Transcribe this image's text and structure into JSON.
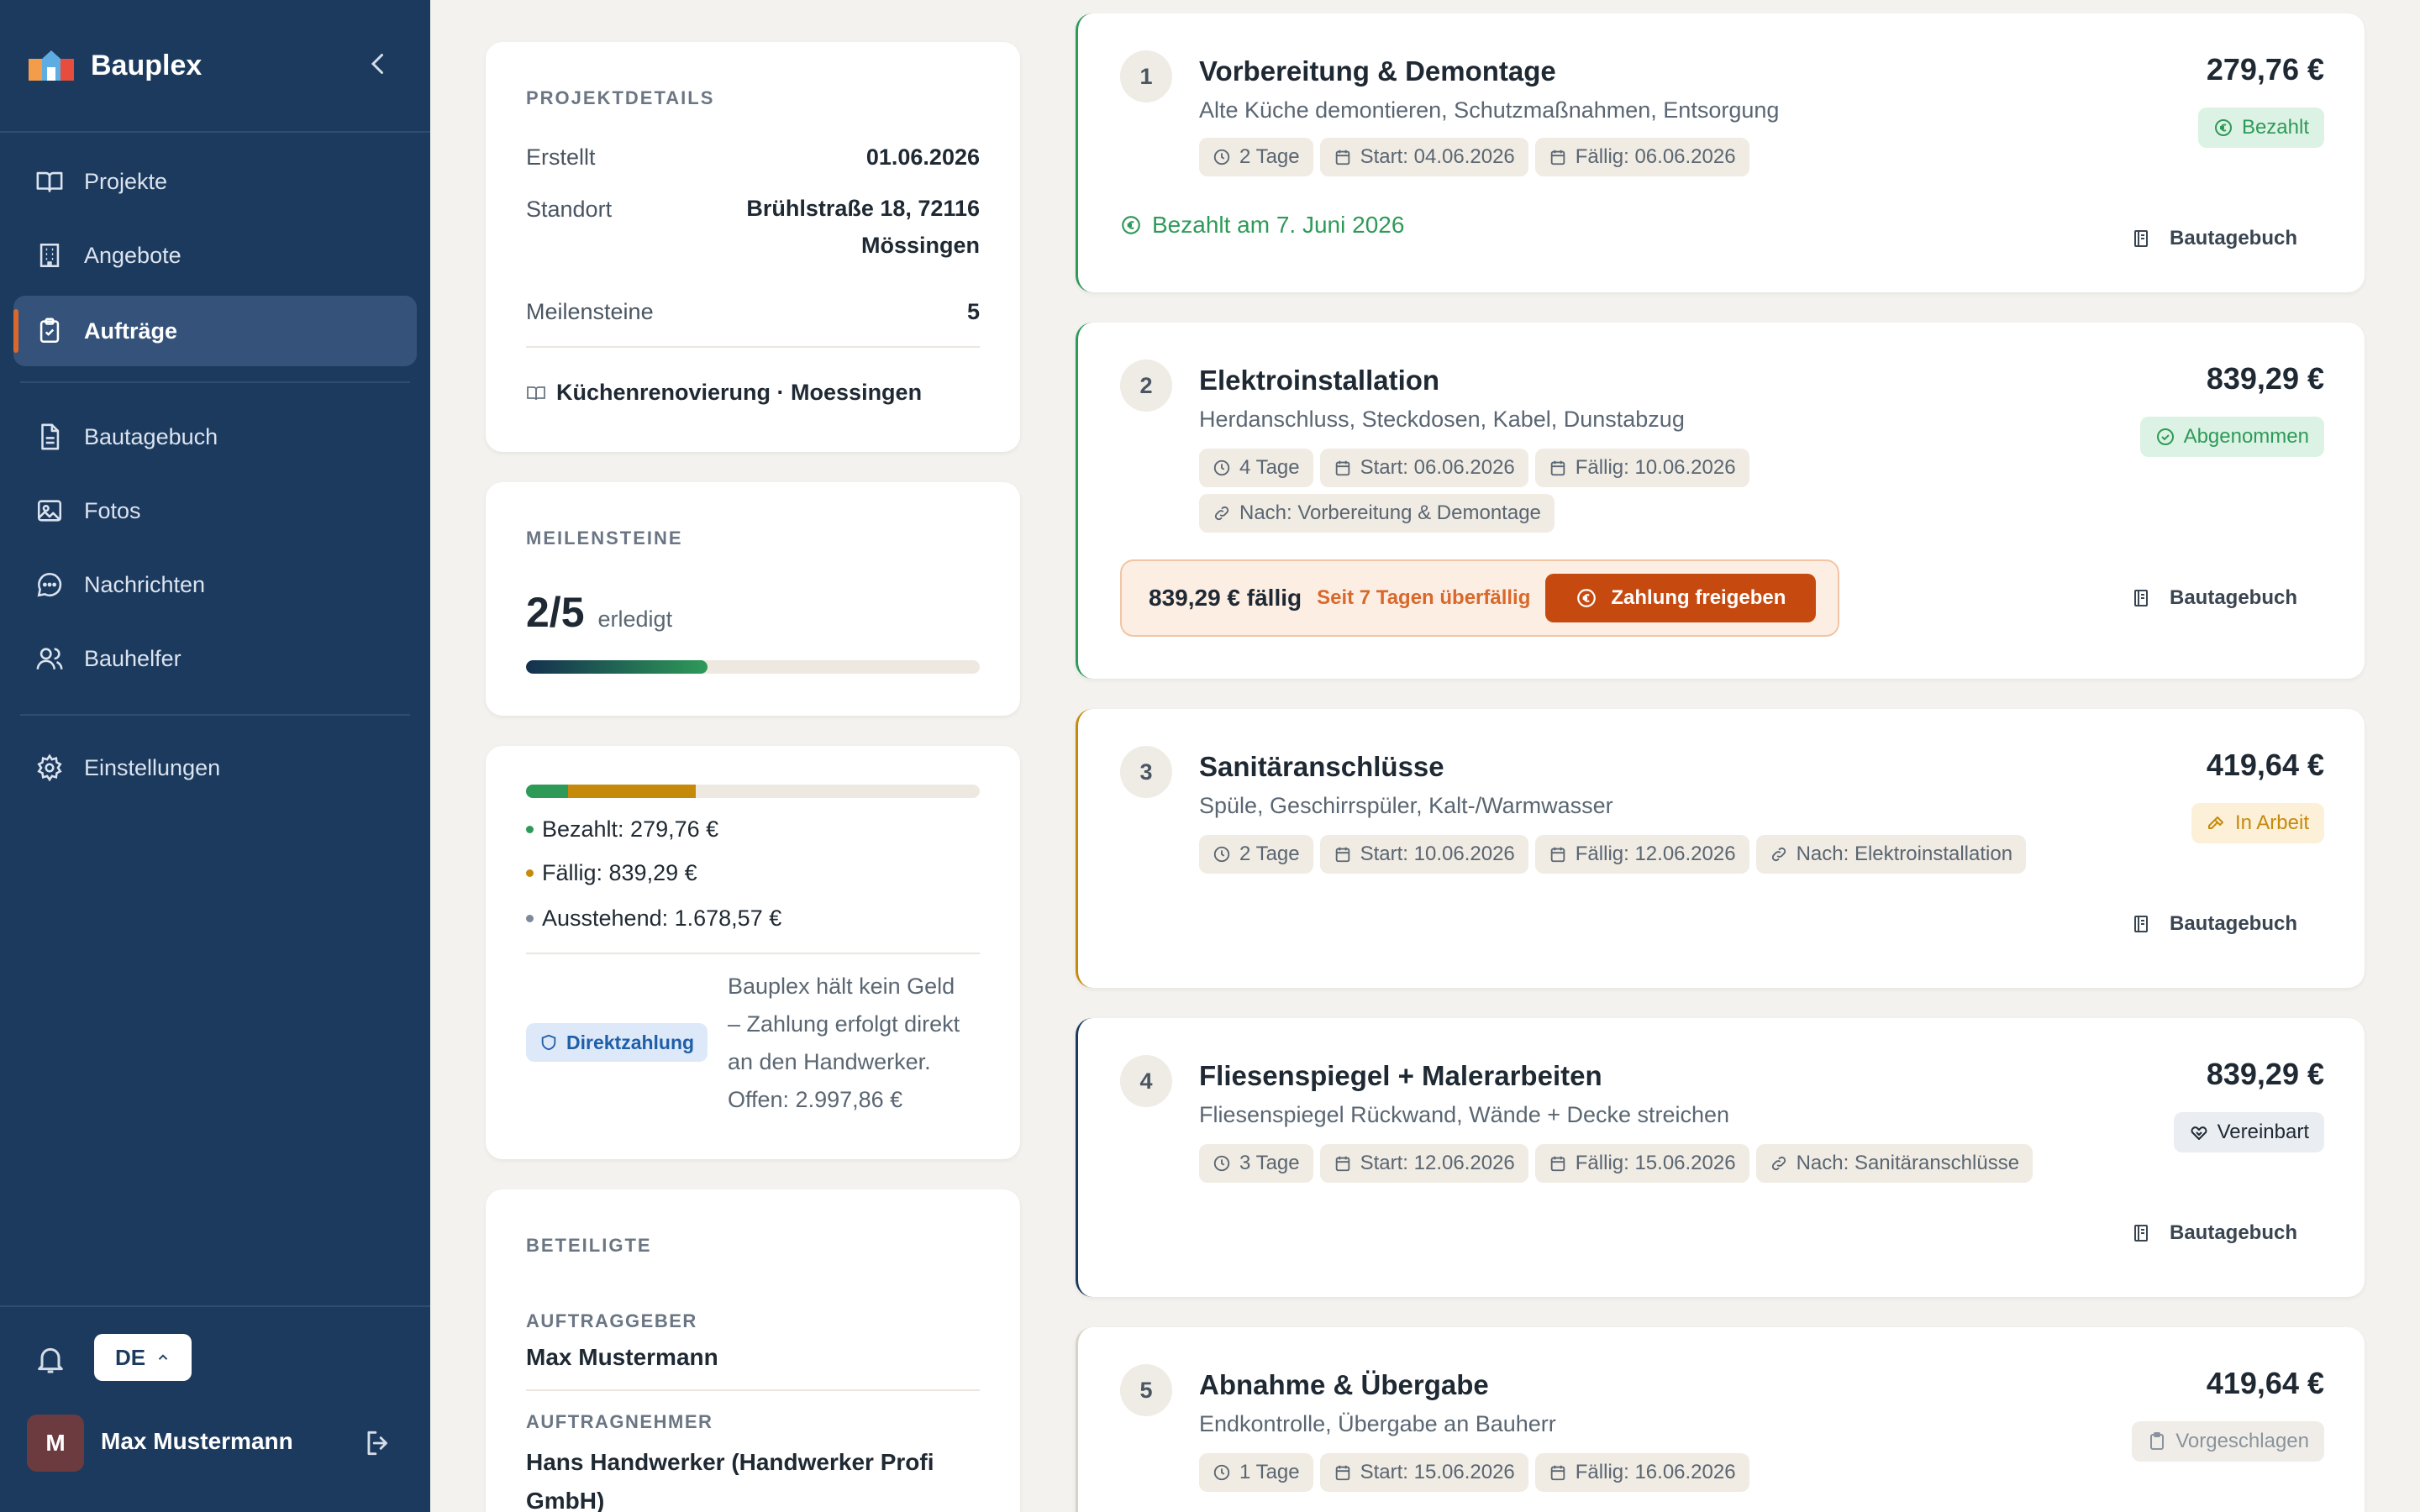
{
  "app": {
    "name": "Bauplex"
  },
  "sidebar": {
    "nav": [
      {
        "label": "Projekte",
        "icon": "book-icon"
      },
      {
        "label": "Angebote",
        "icon": "building-icon"
      },
      {
        "label": "Aufträge",
        "icon": "clipboard-check-icon",
        "active": true
      },
      {
        "label": "Bautagebuch",
        "icon": "document-icon"
      },
      {
        "label": "Fotos",
        "icon": "image-icon"
      },
      {
        "label": "Nachrichten",
        "icon": "chat-icon"
      },
      {
        "label": "Bauhelfer",
        "icon": "users-icon"
      },
      {
        "label": "Einstellungen",
        "icon": "gear-icon"
      }
    ],
    "language": "DE",
    "user": {
      "initial": "M",
      "name": "Max Mustermann"
    }
  },
  "project_details": {
    "title": "PROJEKTDETAILS",
    "rows": [
      {
        "label": "Erstellt",
        "value": "01.06.2026"
      },
      {
        "label": "Standort",
        "value_line1": "Brühlstraße 18, 72116",
        "value_line2": "Mössingen"
      },
      {
        "label": "Meilensteine",
        "value": "5"
      }
    ],
    "project_link": "Küchenrenovierung · Moessingen"
  },
  "milestone_summary": {
    "title": "MEILENSTEINE",
    "done": "2/5",
    "done_label": "erledigt",
    "progress_fraction": 0.4
  },
  "payments": {
    "paid": "Bezahlt: 279,76 €",
    "due": "Fällig: 839,29 €",
    "pending": "Ausstehend: 1.678,57 €",
    "paid_fraction": 0.0933,
    "due_fraction": 0.28,
    "direct_badge": "Direktzahlung",
    "note_lines": [
      "Bauplex hält kein Geld",
      "– Zahlung erfolgt direkt",
      "an den Handwerker.",
      "Offen: 2.997,86 €"
    ],
    "colors": {
      "paid": "#2e9a58",
      "due": "#c68a0b",
      "pending": "#7d8a99"
    }
  },
  "participants": {
    "title": "BETEILIGTE",
    "client_label": "AUFTRAGGEBER",
    "client": "Max Mustermann",
    "contractor_label": "AUFTRAGNEHMER",
    "contractor_line1": "Hans Handwerker (Handwerker Profi",
    "contractor_line2": "GmbH)"
  },
  "milestones": [
    {
      "num": "1",
      "title": "Vorbereitung & Demontage",
      "desc": "Alte Küche demontieren, Schutzmaßnahmen, Entsorgung",
      "price": "279,76 €",
      "status": "Bezahlt",
      "chips": [
        "2 Tage",
        "Start: 04.06.2026",
        "Fällig: 06.06.2026"
      ],
      "paid_note": "Bezahlt am 7. Juni 2026",
      "diary": "Bautagebuch"
    },
    {
      "num": "2",
      "title": "Elektroinstallation",
      "desc": "Herdanschluss, Steckdosen, Kabel, Dunstabzug",
      "price": "839,29 €",
      "status": "Abgenommen",
      "chips": [
        "4 Tage",
        "Start: 06.06.2026",
        "Fällig: 10.06.2026",
        "Nach: Vorbereitung & Demontage"
      ],
      "due_amount": "839,29 € fällig",
      "overdue": "Seit 7 Tagen überfällig",
      "pay_button": "Zahlung freigeben",
      "diary": "Bautagebuch"
    },
    {
      "num": "3",
      "title": "Sanitäranschlüsse",
      "desc": "Spüle, Geschirrspüler, Kalt-/Warmwasser",
      "price": "419,64 €",
      "status": "In Arbeit",
      "chips": [
        "2 Tage",
        "Start: 10.06.2026",
        "Fällig: 12.06.2026",
        "Nach: Elektroinstallation"
      ],
      "diary": "Bautagebuch"
    },
    {
      "num": "4",
      "title": "Fliesenspiegel + Malerarbeiten",
      "desc": "Fliesenspiegel Rückwand, Wände + Decke streichen",
      "price": "839,29 €",
      "status": "Vereinbart",
      "chips": [
        "3 Tage",
        "Start: 12.06.2026",
        "Fällig: 15.06.2026",
        "Nach: Sanitäranschlüsse"
      ],
      "diary": "Bautagebuch"
    },
    {
      "num": "5",
      "title": "Abnahme & Übergabe",
      "desc": "Endkontrolle, Übergabe an Bauherr",
      "price": "419,64 €",
      "status": "Vorgeschlagen",
      "chips": [
        "1 Tage",
        "Start: 15.06.2026",
        "Fällig: 16.06.2026"
      ]
    }
  ],
  "colors": {
    "sidebar_bg": "#1c3a5e",
    "accent_orange": "#d9692b",
    "paid_green": "#2e9a58",
    "in_progress_amber": "#c68a0b",
    "pay_button": "#c64a0f"
  }
}
